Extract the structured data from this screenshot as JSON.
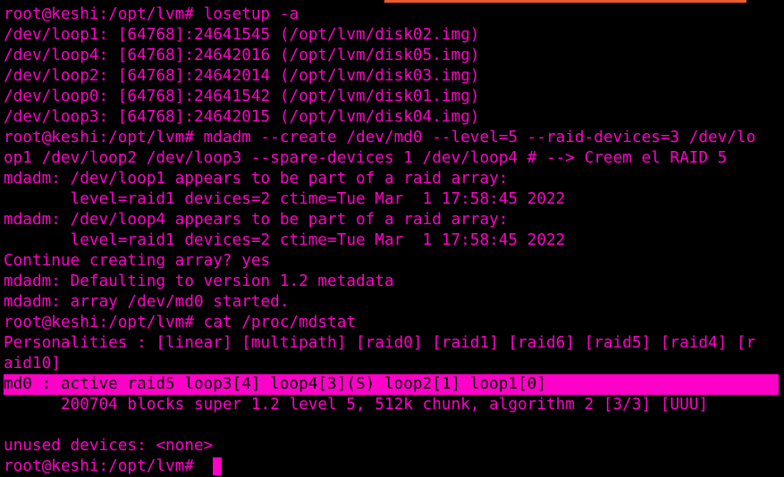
{
  "colors": {
    "background": "#000000",
    "text": "#ff00c8",
    "highlight_bg": "#ff00c8",
    "highlight_text": "#000000",
    "top_accent": "#e85d2a"
  },
  "terminal": {
    "lines": [
      "root@keshi:/opt/lvm# losetup -a",
      "/dev/loop1: [64768]:24641545 (/opt/lvm/disk02.img)",
      "/dev/loop4: [64768]:24642016 (/opt/lvm/disk05.img)",
      "/dev/loop2: [64768]:24642014 (/opt/lvm/disk03.img)",
      "/dev/loop0: [64768]:24641542 (/opt/lvm/disk01.img)",
      "/dev/loop3: [64768]:24642015 (/opt/lvm/disk04.img)",
      "root@keshi:/opt/lvm# mdadm --create /dev/md0 --level=5 --raid-devices=3 /dev/lo",
      "op1 /dev/loop2 /dev/loop3 --spare-devices 1 /dev/loop4 # --> Creem el RAID 5",
      "mdadm: /dev/loop1 appears to be part of a raid array:",
      "       level=raid1 devices=2 ctime=Tue Mar  1 17:58:45 2022",
      "mdadm: /dev/loop4 appears to be part of a raid array:",
      "       level=raid1 devices=2 ctime=Tue Mar  1 17:58:45 2022",
      "Continue creating array? yes",
      "mdadm: Defaulting to version 1.2 metadata",
      "mdadm: array /dev/md0 started.",
      "root@keshi:/opt/lvm# cat /proc/mdstat",
      "Personalities : [linear] [multipath] [raid0] [raid1] [raid6] [raid5] [raid4] [r",
      "aid10]",
      "md0 : active raid5 loop3[4] loop4[3](S) loop2[1] loop1[0]",
      "      200704 blocks super 1.2 level 5, 512k chunk, algorithm 2 [3/3] [UUU]",
      "",
      "unused devices: <none>"
    ],
    "prompt": "root@keshi:/opt/lvm# "
  }
}
